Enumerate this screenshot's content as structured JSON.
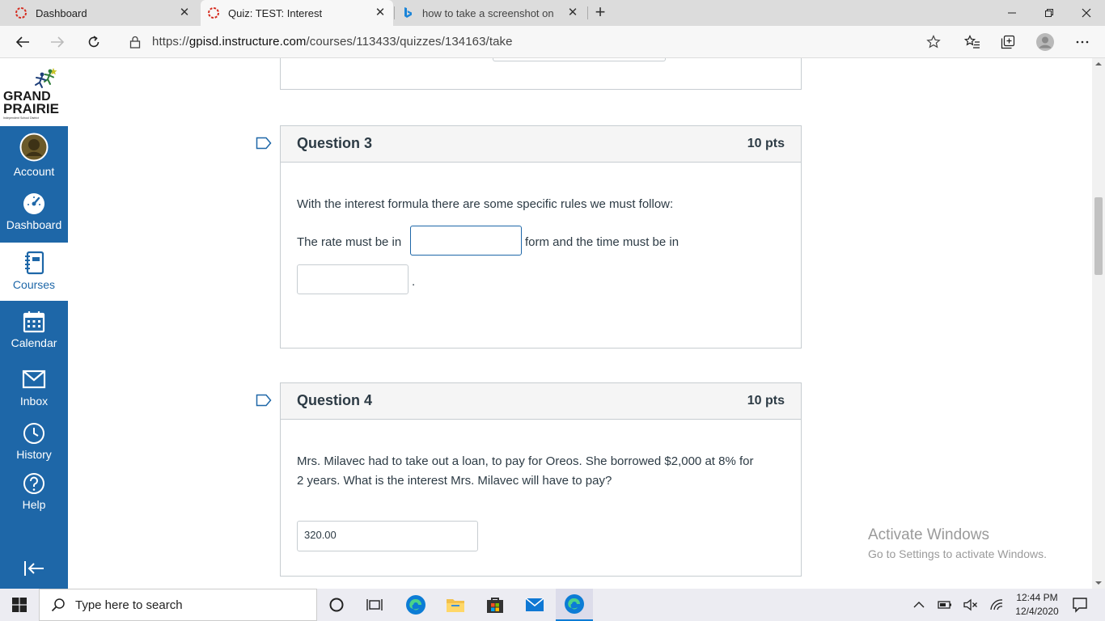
{
  "browser": {
    "tabs": [
      {
        "title": "Dashboard"
      },
      {
        "title": "Quiz: TEST: Interest"
      },
      {
        "title": "how to take a screenshot on com"
      }
    ],
    "url_prefix": "https://",
    "url_host": "gpisd.instructure.com",
    "url_path": "/courses/113433/quizzes/134163/take"
  },
  "leftnav": {
    "logo_line1": "GRAND",
    "logo_line2": "PRAIRIE",
    "logo_line3": "Independent School District",
    "items": [
      {
        "label": "Account"
      },
      {
        "label": "Dashboard"
      },
      {
        "label": "Courses"
      },
      {
        "label": "Calendar"
      },
      {
        "label": "Inbox"
      },
      {
        "label": "History"
      },
      {
        "label": "Help"
      }
    ]
  },
  "quiz": {
    "q3": {
      "title": "Question 3",
      "points": "10 pts",
      "line1": "With the interest formula there are some specific rules we must follow:",
      "part_a": "The rate must be in",
      "part_b": "form and the time must be in",
      "part_end": "."
    },
    "q4": {
      "title": "Question 4",
      "points": "10 pts",
      "line1": "Mrs. Milavec had to take out a loan, to pay for Oreos.  She borrowed $2,000 at 8% for",
      "line2": "2 years.  What is the interest Mrs. Milavec will have to pay?",
      "answer": "320.00"
    }
  },
  "watermark": {
    "line1": "Activate Windows",
    "line2": "Go to Settings to activate Windows."
  },
  "taskbar": {
    "search_placeholder": "Type here to search",
    "time": "12:44 PM",
    "date": "12/4/2020"
  },
  "colors": {
    "canvas_blue": "#1e67a8",
    "edge_blue": "#0c7cd5"
  }
}
